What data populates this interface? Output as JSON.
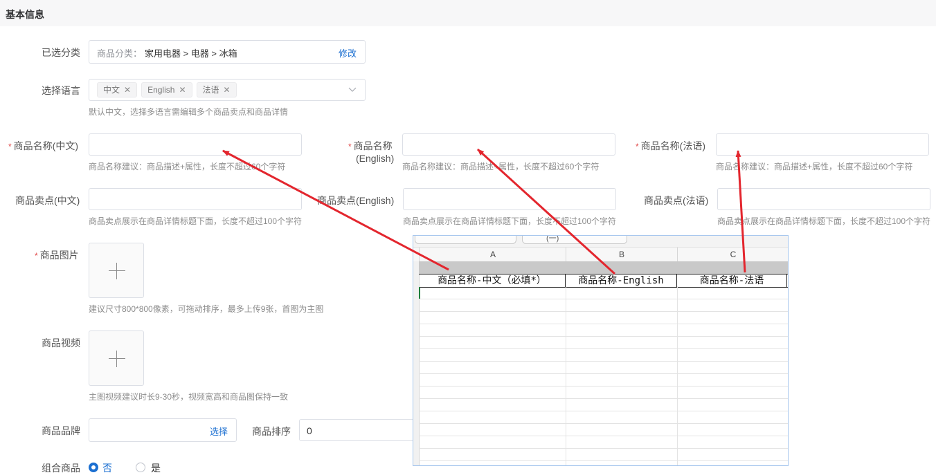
{
  "section": {
    "title": "基本信息"
  },
  "category": {
    "label": "已选分类",
    "prefix": "商品分类：",
    "path": "家用电器 > 电器 > 冰箱",
    "edit_link": "修改"
  },
  "language": {
    "label": "选择语言",
    "tags": [
      "中文",
      "English",
      "法语"
    ],
    "hint": "默认中文，选择多语言需编辑多个商品卖点和商品详情"
  },
  "name_fields": [
    {
      "label": "商品名称(中文)",
      "required": true,
      "value": "",
      "hint": "商品名称建议：商品描述+属性，长度不超过60个字符"
    },
    {
      "label_line1": "商品名称",
      "label_line2": "(English)",
      "required": true,
      "value": "",
      "hint": "商品名称建议：商品描述+属性，长度不超过60个字符"
    },
    {
      "label": "商品名称(法语)",
      "required": true,
      "value": "",
      "hint": "商品名称建议：商品描述+属性，长度不超过60个字符"
    }
  ],
  "selling_fields": [
    {
      "label": "商品卖点(中文)",
      "value": "",
      "hint": "商品卖点展示在商品详情标题下面，长度不超过100个字符"
    },
    {
      "label": "商品卖点(English)",
      "value": "",
      "hint": "商品卖点展示在商品详情标题下面，长度不超过100个字符"
    },
    {
      "label": "商品卖点(法语)",
      "value": "",
      "hint": "商品卖点展示在商品详情标题下面，长度不超过100个字符"
    }
  ],
  "image": {
    "label": "商品图片",
    "required": true,
    "hint": "建议尺寸800*800像素，可拖动排序，最多上传9张，首图为主图"
  },
  "video": {
    "label": "商品视频",
    "hint": "主图视频建议时长9-30秒，视频宽高和商品图保持一致"
  },
  "brand": {
    "label": "商品品牌",
    "select_link": "选择"
  },
  "sort": {
    "label": "商品排序",
    "value": "0"
  },
  "combo": {
    "label": "组合商品",
    "option_no": "否",
    "option_yes": "是",
    "selected": "否"
  },
  "spreadsheet": {
    "columns": [
      "A",
      "B",
      "C"
    ],
    "headers": [
      "商品名称-中文（必填*）",
      "商品名称-English",
      "商品名称-法语"
    ],
    "tab_text": "(一)"
  },
  "colors": {
    "accent": "#1b6fd1",
    "arrow": "#e3262e",
    "required": "#e04848"
  }
}
